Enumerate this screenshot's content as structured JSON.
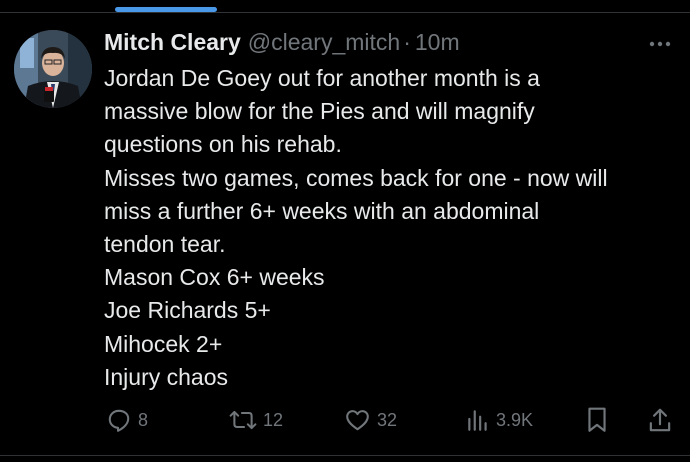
{
  "tweet": {
    "author": {
      "display_name": "Mitch Cleary",
      "handle": "@cleary_mitch",
      "separator": "·",
      "time": "10m",
      "avatar_icon": "profile-photo"
    },
    "body_lines": [
      "Jordan De Goey out for another month is a",
      "massive blow for the Pies and will magnify",
      "questions on his rehab.",
      "Misses two games, comes back for one - now will",
      "miss a further 6+ weeks with an abdominal",
      "tendon tear.",
      "Mason Cox 6+ weeks",
      "Joe Richards 5+",
      "Mihocek 2+",
      "Injury chaos"
    ],
    "actions": {
      "reply": {
        "icon": "reply-icon",
        "count": "8"
      },
      "retweet": {
        "icon": "retweet-icon",
        "count": "12"
      },
      "like": {
        "icon": "heart-icon",
        "count": "32"
      },
      "views": {
        "icon": "views-icon",
        "count": "3.9K"
      },
      "bookmark": {
        "icon": "bookmark-icon"
      },
      "share": {
        "icon": "share-icon"
      }
    },
    "more_icon": "more-icon"
  },
  "colors": {
    "background": "#000000",
    "text_primary": "#e7e9ea",
    "text_secondary": "#71767b",
    "accent": "#4a99e9",
    "divider": "#2f3336"
  }
}
